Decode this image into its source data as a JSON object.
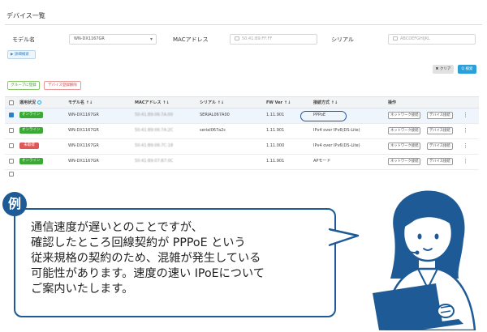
{
  "panel": {
    "title": "デバイス一覧",
    "filters": {
      "model_label": "モデル名",
      "model_value": "WN-DX1167GR",
      "mac_label": "MACアドレス",
      "mac_placeholder": "50:41:B9:FF:FF",
      "serial_label": "シリアル",
      "serial_placeholder": "ABCDEFGHIJKL"
    },
    "detail_button": "▶ 詳細検索",
    "clear_button": "✖ クリア",
    "search_button": "Q 検索",
    "group_button": "グループに登録",
    "delete_button": "デバイス登録解除",
    "table": {
      "headers": [
        "運用状況",
        "モデル名",
        "MACアドレス",
        "シリアル",
        "FW Ver",
        "接続方式",
        "操作"
      ],
      "sort_arrow": "↑↓",
      "rows": [
        {
          "checked": true,
          "status": "オンライン",
          "status_color": "#3aaa35",
          "model": "WN-DX1167GR",
          "mac": "50:41:B9:06:7A:00",
          "serial": "SERIAL067A00",
          "fw": "1.11.901",
          "conn": "PPPoE"
        },
        {
          "checked": false,
          "status": "オンライン",
          "status_color": "#3aaa35",
          "model": "WN-DX1167GR",
          "mac": "50:41:B9:06:7A:2C",
          "serial": "serial067a2c",
          "fw": "1.11.901",
          "conn": "IPv4 over IPv6(DS-Lite)"
        },
        {
          "checked": false,
          "status": "未取得",
          "status_color": "#e05757",
          "model": "WN-DX1167GR",
          "mac": "50:41:B9:06:7C:18",
          "serial": "",
          "fw": "1.11.000",
          "conn": "IPv4 over IPv6(DS-Lite)"
        },
        {
          "checked": false,
          "status": "オンライン",
          "status_color": "#3aaa35",
          "model": "WN-DX1167GR",
          "mac": "50:41:B9:07:B7:0C",
          "serial": "",
          "fw": "1.11.901",
          "conn": "APモード"
        }
      ],
      "network_button": "ネットワーク接続",
      "device_button": "デバイス接続",
      "more_icon": "⋮"
    }
  },
  "example_label": "例",
  "bubble_lines": [
    "通信速度が遅いとのことですが、",
    "確認したところ回線契約が PPPoE という",
    "従来規格の契約のため、混雑が発生している",
    "可能性があります。速度の速い IPoEについて",
    "ご案内いたします。"
  ],
  "colors": {
    "accent": "#1d5a96",
    "online": "#3aaa35",
    "offline": "#e05757",
    "primary_button": "#2d9fd8"
  }
}
